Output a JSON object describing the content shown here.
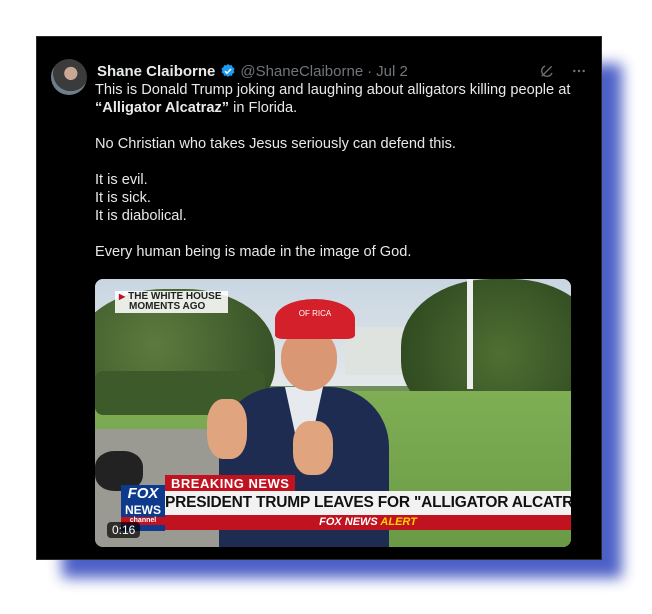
{
  "post": {
    "author_name": "Shane Claiborne",
    "handle": "@ShaneClaiborne",
    "separator": "·",
    "date": "Jul 2",
    "icons": {
      "verified": "verified-badge-icon",
      "grok": "grok-icon",
      "more": "more-options-icon"
    },
    "text": {
      "line1_before": "This is Donald Trump joking and laughing about alligators killing people at",
      "line2_bold": "“Alligator Alcatraz”",
      "line2_after": " in Florida.",
      "para2": "No Christian who takes Jesus seriously can defend this.",
      "para3_1": "It is evil.",
      "para3_2": "It is sick.",
      "para3_3": "It is diabolical.",
      "para4": "Every human being is made in the image of God."
    },
    "video": {
      "corner_badge_line1": "THE WHITE HOUSE",
      "corner_badge_line2": "MOMENTS AGO",
      "cap_text_1": "OF",
      "cap_text_2": "RICA",
      "breaking_label": "BREAKING NEWS",
      "headline": "PRESIDENT TRUMP LEAVES FOR \"ALLIGATOR ALCATRAZ\"",
      "alert_prefix": "FOX NEWS ",
      "alert_word": "ALERT",
      "network_logo_1": "FOX",
      "network_logo_2": "NEWS",
      "network_logo_3": "channel",
      "duration": "0:16"
    }
  },
  "colors": {
    "background": "#000000",
    "text_primary": "#e7e9ea",
    "text_secondary": "#71767b",
    "verified_blue": "#1d9bf0",
    "fox_red": "#c1121f",
    "frame_shadow": "#3a4fc0"
  }
}
